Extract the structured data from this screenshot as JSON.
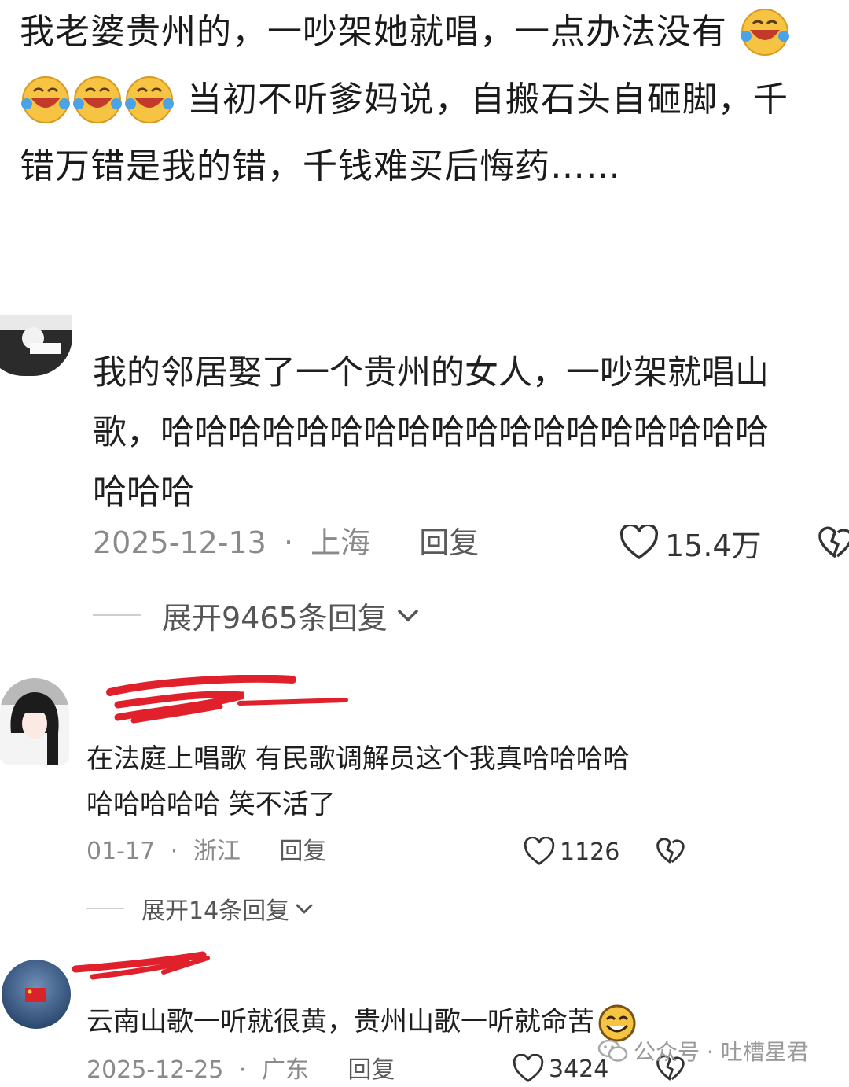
{
  "post": {
    "line1": "我老婆贵州的，一吵架她就唱，一点办法没有",
    "line2": "当初不听爹妈说，自搬石头自砸脚，千",
    "line3": "错万错是我的错，千钱难买后悔药……",
    "emoji_name": "crying-laughing-emoji"
  },
  "comments": [
    {
      "text_lines": [
        "我的邻居娶了一个贵州的女人，一吵架就唱山",
        "歌，哈哈哈哈哈哈哈哈哈哈哈哈哈哈哈哈哈哈",
        "哈哈哈"
      ],
      "date": "2025-12-13",
      "sep": "·",
      "location": "上海",
      "reply": "回复",
      "likes": "15.4万",
      "expand": "展开9465条回复"
    },
    {
      "text_lines": [
        "在法庭上唱歌 有民歌调解员这个我真哈哈哈哈",
        "哈哈哈哈哈 笑不活了"
      ],
      "date": "01-17",
      "sep": "·",
      "location": "浙江",
      "reply": "回复",
      "likes": "1126",
      "expand": "展开14条回复"
    },
    {
      "text_lines": [
        "云南山歌一听就很黄，贵州山歌一听就命苦"
      ],
      "date": "2025-12-25",
      "sep": "·",
      "location": "广东",
      "reply": "回复",
      "likes": "3424"
    }
  ],
  "watermark": {
    "text": "公众号 · 吐槽星君",
    "icon": "wechat-icon"
  },
  "colors": {
    "meta": "#8a8a8a",
    "redact": "#e0202a",
    "emoji_face": "#f6c343"
  }
}
